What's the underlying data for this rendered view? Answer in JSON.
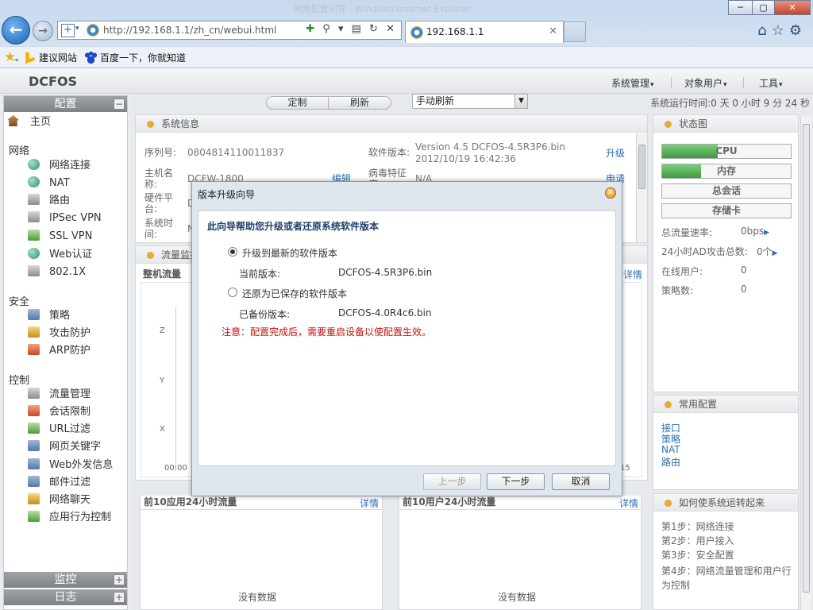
{
  "browser": {
    "title_ghost": "网络配置向导 - Windows Internet Explorer",
    "url": "http://192.168.1.1/zh_cn/webui.html",
    "tab_label": "192.168.1.1",
    "win_minimize": "─",
    "win_maximize": "▢",
    "win_close": "✕",
    "favorites": [
      "建议网站",
      "百度一下，你就知道"
    ]
  },
  "header": {
    "logo": "DCFOS",
    "menus": [
      "系统管理",
      "对象用户",
      "工具"
    ]
  },
  "sidebar": {
    "config_title": "配置",
    "config_toggle": "−",
    "home": "主页",
    "groups": [
      {
        "title": "网络",
        "items": [
          "网络连接",
          "NAT",
          "路由",
          "IPSec VPN",
          "SSL VPN",
          "Web认证",
          "802.1X"
        ]
      },
      {
        "title": "安全",
        "items": [
          "策略",
          "攻击防护",
          "ARP防护"
        ]
      },
      {
        "title": "控制",
        "items": [
          "流量管理",
          "会话限制",
          "URL过滤",
          "网页关键字",
          "Web外发信息",
          "邮件过滤",
          "网络聊天",
          "应用行为控制"
        ]
      }
    ],
    "monitor_title": "监控",
    "log_title": "日志",
    "plus": "+"
  },
  "toolbar": {
    "custom": "定制",
    "refresh": "刷新",
    "refresh_mode": "手动刷新",
    "runtime": "系统运行时间:0 天 0 小时 9 分 24 秒"
  },
  "sysinfo": {
    "title": "系统信息",
    "serial_label": "序列号:",
    "serial": "0804814110011837",
    "sw_label": "软件版本:",
    "sw_version": "Version 4.5 DCFOS-4.5R3P6.bin",
    "sw_date": "2012/10/19 16:42:36",
    "upgrade": "升级",
    "host_label_1": "主机名",
    "host_label_2": "称:",
    "host": "DCFW-1800",
    "edit": "编辑",
    "virus_label_1": "病毒特征",
    "virus_label_2": "库:",
    "virus": "N/A",
    "apply": "申请",
    "hw_label_1": "硬件平",
    "hw_label_2": "台:",
    "hw_partial": "D",
    "time_label_1": "系统时",
    "time_label_2": "间:",
    "time_partial": "N"
  },
  "traffic": {
    "title": "流量监控",
    "subtitle": "整机流量",
    "details": "详情",
    "y_ticks": [
      "Z",
      "Y",
      "X"
    ],
    "x_start": "00:00",
    "x_end": "15"
  },
  "status": {
    "title": "状态图",
    "cpu": "CPU",
    "cpu_level": 0.43,
    "memory": "内存",
    "memory_level": 0.3,
    "sessions": "总会话",
    "storage": "存储卡",
    "traffic_rate_label": "总流量速率:",
    "traffic_rate": "0bps",
    "attacks_label": "24小时AD攻击总数:",
    "attacks": "0个",
    "online_label": "在线用户:",
    "online": "0",
    "policies_label": "策略数:",
    "policies": "0"
  },
  "common": {
    "title": "常用配置",
    "links": [
      "接口",
      "策略",
      "NAT",
      "路由"
    ]
  },
  "howto": {
    "title": "如何使系统运转起来",
    "steps": [
      "第1步：网络连接",
      "第2步：用户接入",
      "第3步：安全配置",
      "第4步：网络流量管理和用户行为控制"
    ]
  },
  "top10_apps": {
    "title": "前10应用24小时流量",
    "details": "详情",
    "empty": "没有数据"
  },
  "top10_users": {
    "title": "前10用户24小时流量",
    "details": "详情",
    "empty": "没有数据"
  },
  "dialog": {
    "title": "版本升级向导",
    "heading": "此向导帮助您升级或者还原系统软件版本",
    "option_upgrade": "升级到最新的软件版本",
    "current_label": "当前版本:",
    "current_version": "DCFOS-4.5R3P6.bin",
    "option_restore": "还原为已保存的软件版本",
    "backup_label": "已备份版本:",
    "backup_version": "DCFOS-4.0R4c6.bin",
    "warning": "注意：配置完成后，需要重启设备以使配置生效。",
    "prev": "上一步",
    "next": "下一步",
    "cancel": "取消"
  }
}
